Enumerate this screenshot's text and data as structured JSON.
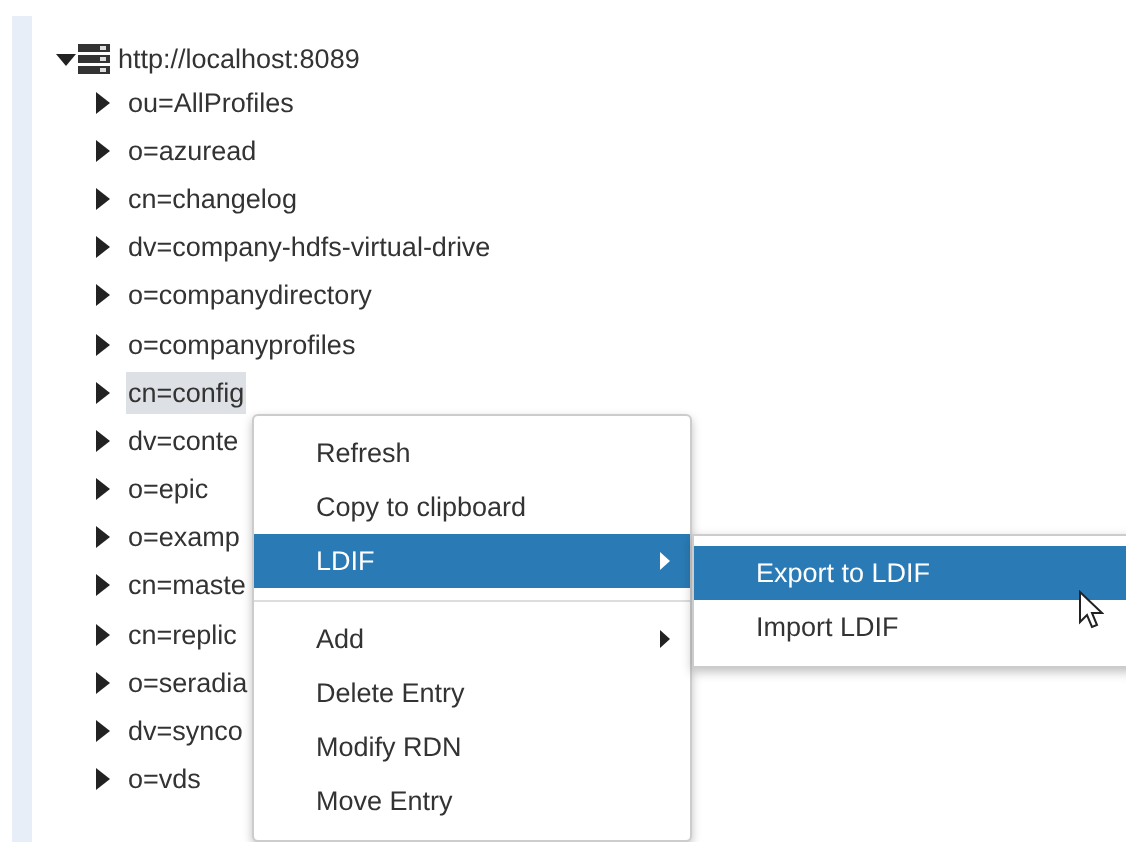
{
  "tree": {
    "root": {
      "label": "http://localhost:8089",
      "expanded": true,
      "children": [
        {
          "label": "ou=AllProfiles",
          "selected": false
        },
        {
          "label": "o=azuread",
          "selected": false
        },
        {
          "label": "cn=changelog",
          "selected": false
        },
        {
          "label": "dv=company-hdfs-virtual-drive",
          "selected": false
        },
        {
          "label": "o=companydirectory",
          "selected": false
        },
        {
          "label": "o=companyprofiles",
          "selected": false
        },
        {
          "label": "cn=config",
          "selected": true
        },
        {
          "label": "dv=conte",
          "selected": false
        },
        {
          "label": "o=epic",
          "selected": false
        },
        {
          "label": "o=examp",
          "selected": false
        },
        {
          "label": "cn=maste",
          "selected": false
        },
        {
          "label": "cn=replic",
          "selected": false
        },
        {
          "label": "o=seradia",
          "selected": false
        },
        {
          "label": "dv=synco",
          "selected": false
        },
        {
          "label": "o=vds",
          "selected": false
        }
      ]
    }
  },
  "context_menu": {
    "items": [
      {
        "kind": "item",
        "label": "Refresh",
        "selected": false,
        "submenu": false
      },
      {
        "kind": "item",
        "label": "Copy to clipboard",
        "selected": false,
        "submenu": false
      },
      {
        "kind": "item",
        "label": "LDIF",
        "selected": true,
        "submenu": true
      },
      {
        "kind": "separator"
      },
      {
        "kind": "item",
        "label": "Add",
        "selected": false,
        "submenu": true
      },
      {
        "kind": "item",
        "label": "Delete Entry",
        "selected": false,
        "submenu": false
      },
      {
        "kind": "item",
        "label": "Modify RDN",
        "selected": false,
        "submenu": false
      },
      {
        "kind": "item",
        "label": "Move Entry",
        "selected": false,
        "submenu": false
      }
    ]
  },
  "submenu": {
    "items": [
      {
        "label": "Export to LDIF",
        "selected": true
      },
      {
        "label": "Import LDIF",
        "selected": false
      }
    ]
  }
}
